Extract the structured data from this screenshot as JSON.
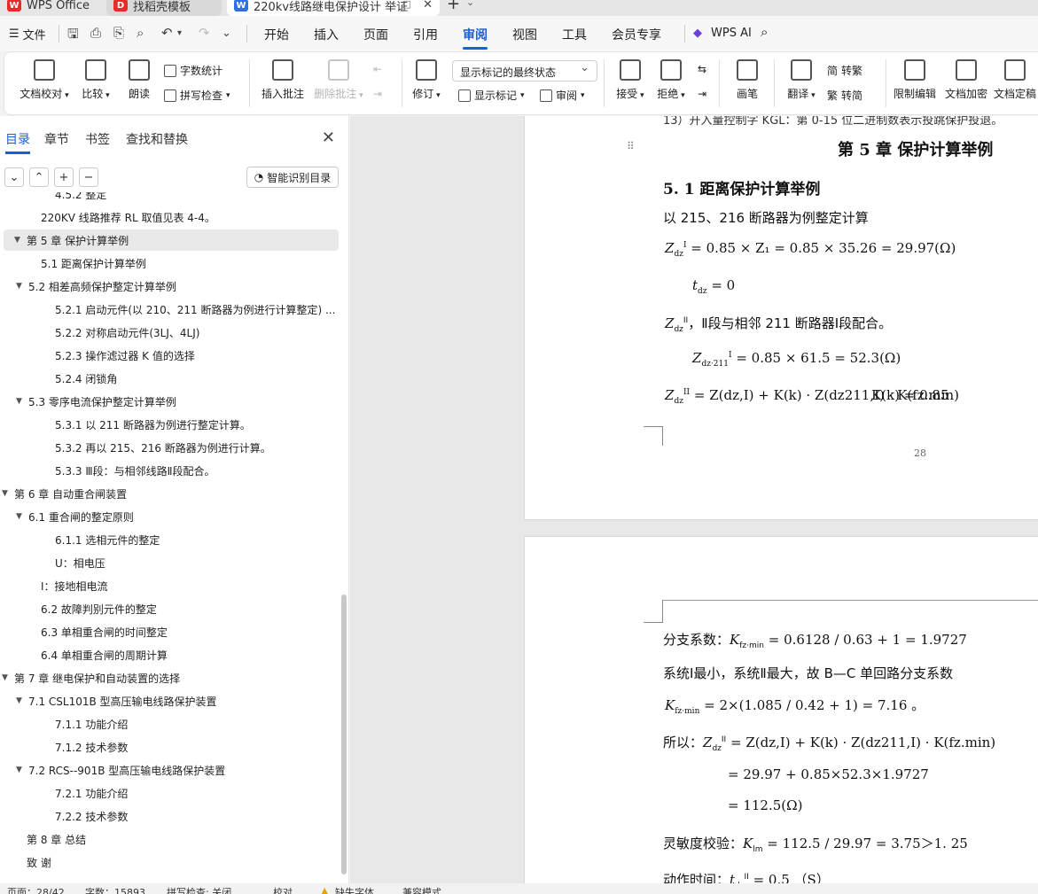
{
  "tabs": [
    {
      "label": "WPS Office"
    },
    {
      "label": "找稻壳模板"
    },
    {
      "label": "220kv线路继电保护设计 举证"
    }
  ],
  "menu": {
    "file": "文件",
    "tabs": [
      "开始",
      "插入",
      "页面",
      "引用",
      "审阅",
      "视图",
      "工具",
      "会员专享"
    ],
    "active_tab": "审阅",
    "wps_ai": "WPS AI"
  },
  "ribbon": {
    "doc_proof": "文档校对",
    "compare": "比较",
    "read_aloud": "朗读",
    "word_count": "字数统计",
    "spell_check": "拼写检查",
    "insert_comment": "插入批注",
    "delete_comment": "删除批注",
    "revise": "修订",
    "display_state": "显示标记的最终状态",
    "show_markup": "显示标记",
    "review": "审阅",
    "accept": "接受",
    "reject": "拒绝",
    "brush": "画笔",
    "translate": "翻译",
    "to_traditional": "转繁",
    "to_simplified": "转简",
    "restrict_edit": "限制编辑",
    "encrypt": "文档加密",
    "finalize": "文档定稿"
  },
  "nav": {
    "tabs": [
      "目录",
      "章节",
      "书签",
      "查找和替换"
    ],
    "active_tab": "目录",
    "smart_toc": "智能识别目录",
    "items": [
      {
        "text": "4.5.2  整定",
        "level": 3,
        "expander": ""
      },
      {
        "text": "220KV 线路推荐 RL 取值见表 4-4。",
        "level": 2,
        "expander": ""
      },
      {
        "text": "第 5 章   保护计算举例",
        "level": 1,
        "expander": "open",
        "selected": true
      },
      {
        "text": "5.1  距离保护计算举例",
        "level": 2,
        "expander": ""
      },
      {
        "text": "5.2    相差高频保护整定计算举例",
        "level": 2,
        "expander": "open"
      },
      {
        "text": "5.2.1 启动元件(以 210、211 断路器为例进行计算整定) ...",
        "level": 3,
        "expander": ""
      },
      {
        "text": "5.2.2 对称启动元件(3LJ、4LJ)",
        "level": 3,
        "expander": ""
      },
      {
        "text": "5.2.3 操作滤过器 K 值的选择",
        "level": 3,
        "expander": ""
      },
      {
        "text": "5.2.4    闭锁角",
        "level": 3,
        "expander": ""
      },
      {
        "text": "5.3    零序电流保护整定计算举例",
        "level": 2,
        "expander": "open"
      },
      {
        "text": "5.3.1    以 211 断路器为例进行整定计算。",
        "level": 3,
        "expander": ""
      },
      {
        "text": "5.3.2    再以 215、216 断路器为例进行计算。",
        "level": 3,
        "expander": ""
      },
      {
        "text": "5.3.3    Ⅲ段：与相邻线路Ⅱ段配合。",
        "level": 3,
        "expander": ""
      },
      {
        "text": "第 6 章   自动重合闸装置",
        "level": 1,
        "expander": "open"
      },
      {
        "text": "6.1  重合闸的整定原则",
        "level": 2,
        "expander": "open"
      },
      {
        "text": "6.1.1 选相元件的整定",
        "level": 3,
        "expander": ""
      },
      {
        "text": "U：相电压",
        "level": 3,
        "expander": ""
      },
      {
        "text": "I：接地相电流",
        "level": 2,
        "expander": ""
      },
      {
        "text": "6.2    故障判别元件的整定",
        "level": 2,
        "expander": ""
      },
      {
        "text": "6.3  单相重合闸的时间整定",
        "level": 2,
        "expander": ""
      },
      {
        "text": "6.4    单相重合闸的周期计算",
        "level": 2,
        "expander": ""
      },
      {
        "text": "第 7 章  继电保护和自动装置的选择",
        "level": 1,
        "expander": "open"
      },
      {
        "text": "7.1 CSL101B 型高压输电线路保护装置",
        "level": 2,
        "expander": "open"
      },
      {
        "text": "7.1.1 功能介绍",
        "level": 3,
        "expander": ""
      },
      {
        "text": "7.1.2 技术参数",
        "level": 3,
        "expander": ""
      },
      {
        "text": "7.2    RCS--901B 型高压输电线路保护装置",
        "level": 2,
        "expander": "open"
      },
      {
        "text": "7.2.1 功能介绍",
        "level": 3,
        "expander": ""
      },
      {
        "text": "7.2.2    技术参数",
        "level": 3,
        "expander": ""
      },
      {
        "text": "第 8 章   总结",
        "level": 1,
        "expander": ""
      },
      {
        "text": "致        谢",
        "level": 1,
        "expander": ""
      }
    ]
  },
  "doc": {
    "page1": {
      "top_cut": "13）开入量控制字 KGL：第 0-15 位二进制数表示投跳保护投退。",
      "chapter": "第 5 章    保护计算举例",
      "section": "5. 1  距离保护计算举例",
      "intro": "以 215、216 断路器为例整定计算",
      "f1": "= 0.85 × Z₁ = 0.85 × 35.26 = 29.97(Ω)",
      "f2": "= 0",
      "f3_text": "，Ⅱ段与相邻 211 断路器Ⅰ段配合。",
      "f4": "= 0.85 × 61.5 = 52.3(Ω)",
      "f5": "= Z(dz,I) + K(k) · Z(dz211,I) · K(fz.min)",
      "f5_k": "K(k) = 0.85",
      "page_number": "28"
    },
    "page2": {
      "l1_label": "分支系数：",
      "l1": "= 0.6128 / 0.63 + 1 = 1.9727",
      "l2": "系统Ⅰ最小，系统Ⅱ最大，故 B—C 单回路分支系数",
      "l3": "= 2×(1.085 / 0.42 + 1) = 7.16 。",
      "l4_label": "所以：",
      "l4": "= Z(dz,I) + K(k) · Z(dz211,I) · K(fz.min)",
      "l5": "= 29.97 + 0.85×52.3×1.9727",
      "l6": "= 112.5(Ω)",
      "l7_label": "灵敏度校验：",
      "l7": "= 112.5 / 29.97 = 3.75＞1. 25",
      "l8_label": "动作时间：",
      "l8": "= 0.5    （S）"
    }
  },
  "status": {
    "page": "页面：28/42",
    "words": "字数：15893",
    "spell": "拼写检查: 关闭",
    "proof": "校对",
    "missing_font": "缺失字体",
    "compat": "兼容模式"
  }
}
